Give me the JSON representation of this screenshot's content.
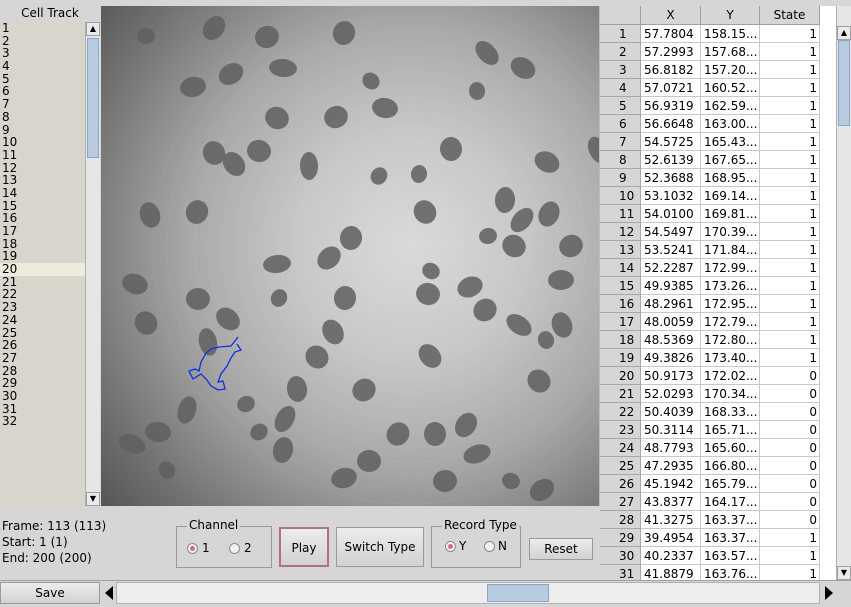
{
  "cell_track": {
    "title": "Cell Track",
    "items": [
      "1",
      "2",
      "3",
      "4",
      "5",
      "6",
      "7",
      "8",
      "9",
      "10",
      "11",
      "12",
      "13",
      "14",
      "15",
      "16",
      "17",
      "18",
      "19",
      "20",
      "21",
      "22",
      "23",
      "24",
      "25",
      "26",
      "27",
      "28",
      "29",
      "30",
      "31",
      "32"
    ],
    "selected": "20"
  },
  "info": {
    "frame": "Frame: 113 (113)",
    "start": "Start: 1 (1)",
    "end": "End: 200 (200)"
  },
  "channel": {
    "title": "Channel",
    "option1": "1",
    "option2": "2",
    "selected": "1"
  },
  "buttons": {
    "play": "Play",
    "switch_type": "Switch Type",
    "reset": "Reset",
    "save": "Save"
  },
  "record_type": {
    "title": "Record Type",
    "option_y": "Y",
    "option_n": "N",
    "selected": "Y"
  },
  "table": {
    "headers": [
      "",
      "X",
      "Y",
      "State"
    ],
    "rows": [
      [
        "1",
        "57.7804",
        "158.15...",
        "1"
      ],
      [
        "2",
        "57.2993",
        "157.68...",
        "1"
      ],
      [
        "3",
        "56.8182",
        "157.20...",
        "1"
      ],
      [
        "4",
        "57.0721",
        "160.52...",
        "1"
      ],
      [
        "5",
        "56.9319",
        "162.59...",
        "1"
      ],
      [
        "6",
        "56.6648",
        "163.00...",
        "1"
      ],
      [
        "7",
        "54.5725",
        "165.43...",
        "1"
      ],
      [
        "8",
        "52.6139",
        "167.65...",
        "1"
      ],
      [
        "9",
        "52.3688",
        "168.95...",
        "1"
      ],
      [
        "10",
        "53.1032",
        "169.14...",
        "1"
      ],
      [
        "11",
        "54.0100",
        "169.81...",
        "1"
      ],
      [
        "12",
        "54.5497",
        "170.39...",
        "1"
      ],
      [
        "13",
        "53.5241",
        "171.84...",
        "1"
      ],
      [
        "14",
        "52.2287",
        "172.99...",
        "1"
      ],
      [
        "15",
        "49.9385",
        "173.26...",
        "1"
      ],
      [
        "16",
        "48.2961",
        "172.95...",
        "1"
      ],
      [
        "17",
        "48.0059",
        "172.79...",
        "1"
      ],
      [
        "18",
        "48.5369",
        "172.80...",
        "1"
      ],
      [
        "19",
        "49.3826",
        "173.40...",
        "1"
      ],
      [
        "20",
        "50.9173",
        "172.02...",
        "0"
      ],
      [
        "21",
        "52.0293",
        "170.34...",
        "0"
      ],
      [
        "22",
        "50.4039",
        "168.33...",
        "0"
      ],
      [
        "23",
        "50.3114",
        "165.71...",
        "0"
      ],
      [
        "24",
        "48.7793",
        "165.60...",
        "0"
      ],
      [
        "25",
        "47.2935",
        "166.80...",
        "0"
      ],
      [
        "26",
        "45.1942",
        "165.79...",
        "0"
      ],
      [
        "27",
        "43.8377",
        "164.17...",
        "0"
      ],
      [
        "28",
        "41.3275",
        "163.37...",
        "0"
      ],
      [
        "29",
        "39.4954",
        "163.37...",
        "1"
      ],
      [
        "30",
        "40.2337",
        "163.57...",
        "1"
      ],
      [
        "31",
        "41.8879",
        "163.76...",
        "1"
      ]
    ]
  },
  "colors": {
    "track": "#1030e0",
    "radio_selected": "#d06a8a",
    "scroll_thumb": "#b9cbe0"
  }
}
